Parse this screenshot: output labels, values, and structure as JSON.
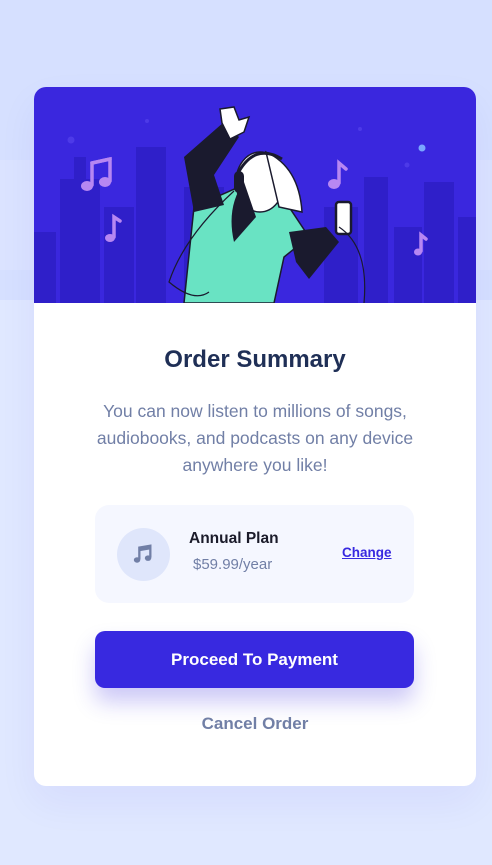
{
  "order": {
    "title": "Order Summary",
    "description": "You can now listen to millions of songs, audiobooks, and podcasts on any device anywhere you like!"
  },
  "plan": {
    "name": "Annual Plan",
    "price": "$59.99/year",
    "change_label": "Change",
    "icon": "music-note-icon"
  },
  "actions": {
    "proceed_label": "Proceed To Payment",
    "cancel_label": "Cancel Order"
  },
  "colors": {
    "accent": "#3829e0",
    "page_background": "#e0e8ff",
    "title_text": "#1f2f56",
    "muted_text": "#717fa6",
    "plan_background": "#f5f7ff"
  }
}
